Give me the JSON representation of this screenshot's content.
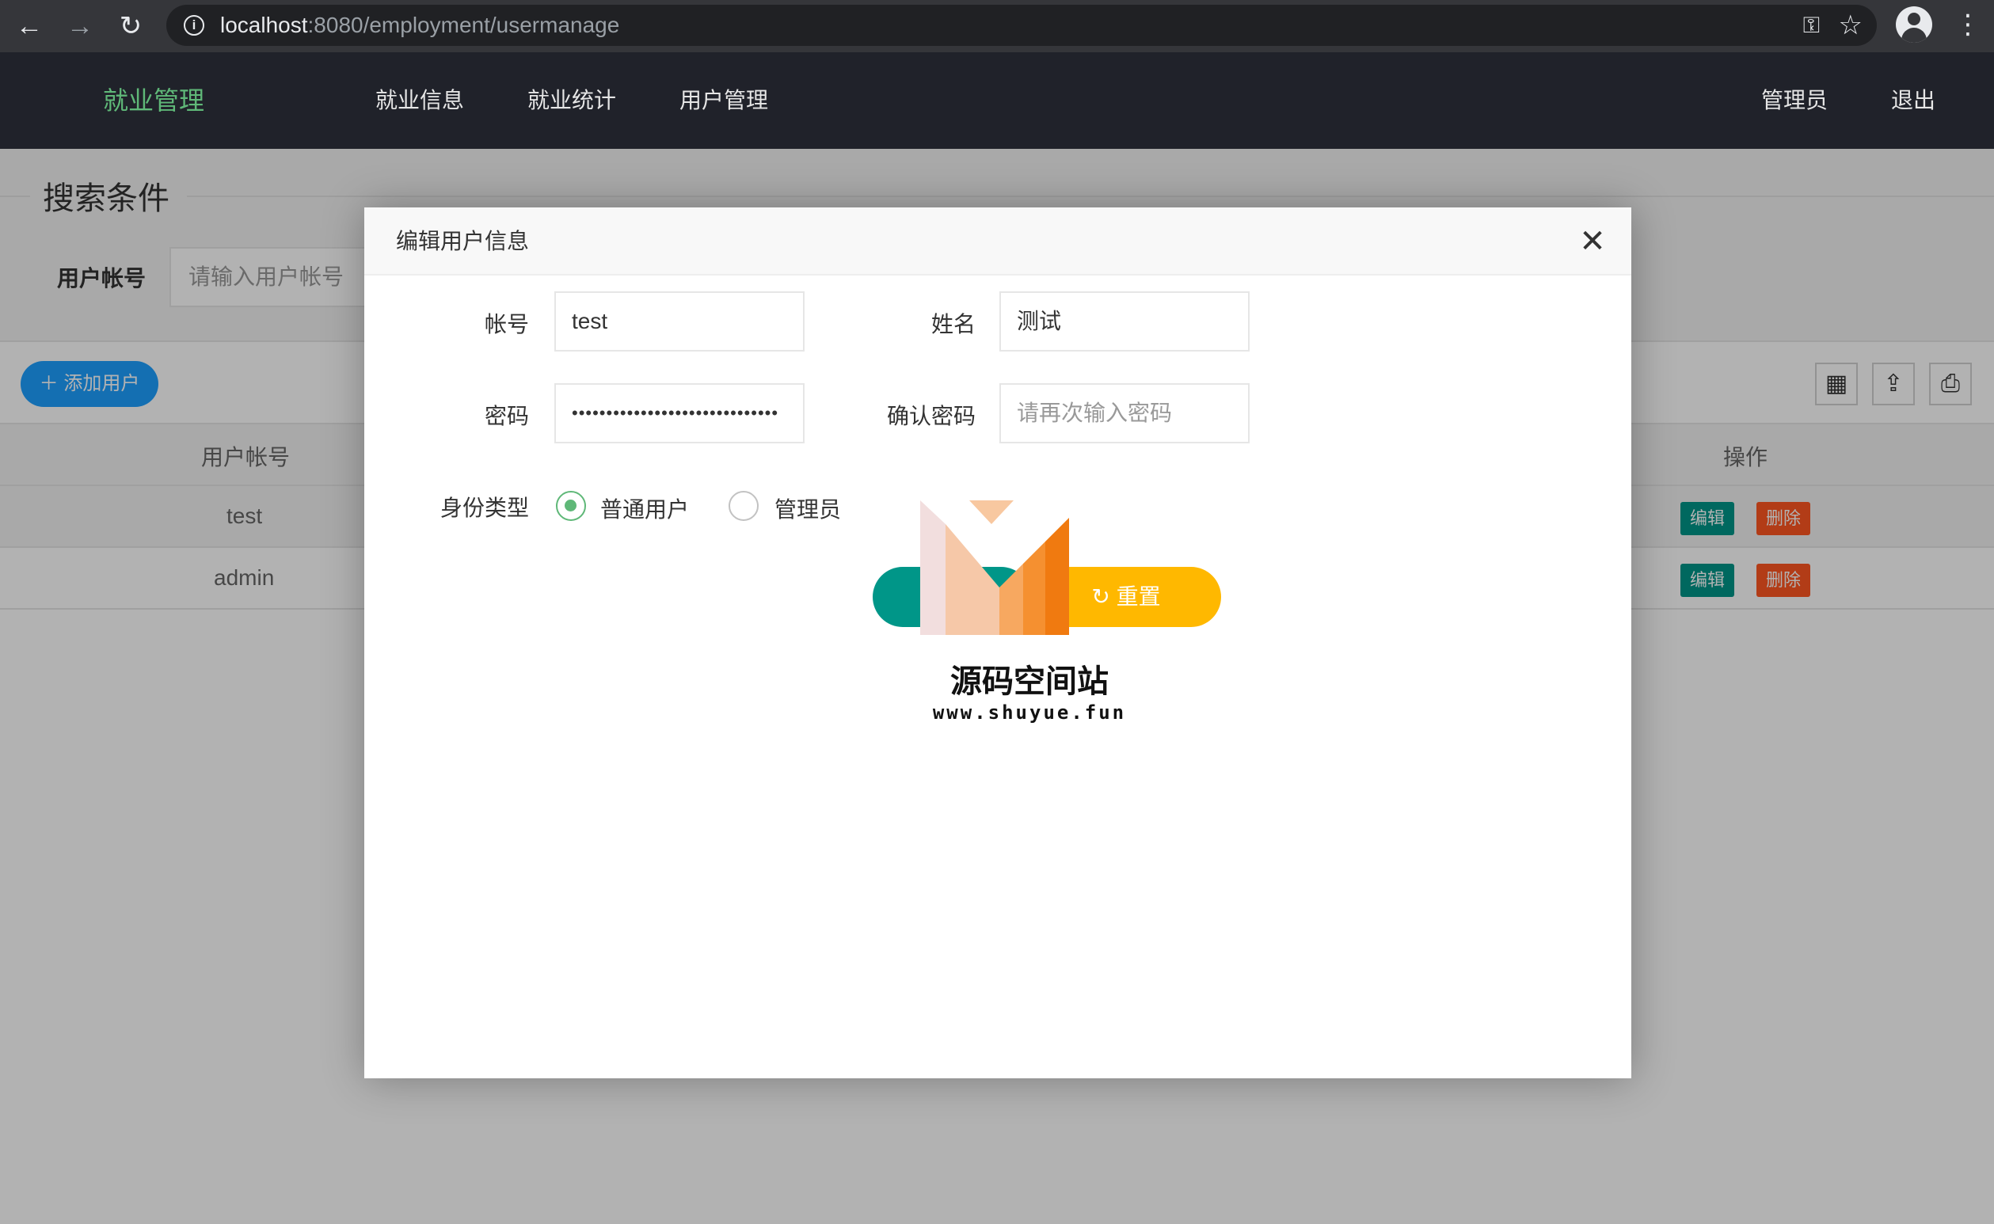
{
  "browser": {
    "url_host": "localhost",
    "url_path": ":8080/employment/usermanage"
  },
  "header": {
    "brand": "就业管理",
    "nav": [
      "就业信息",
      "就业统计",
      "用户管理"
    ],
    "right": [
      "管理员",
      "退出"
    ]
  },
  "search": {
    "legend": "搜索条件",
    "label": "用户帐号",
    "placeholder": "请输入用户帐号"
  },
  "toolbar": {
    "add_label": "添加用户",
    "icons": [
      "columns-icon",
      "export-icon",
      "print-icon"
    ]
  },
  "table": {
    "headers": {
      "account": "用户帐号",
      "actions": "操作"
    },
    "rows": [
      {
        "account": "test",
        "edit": "编辑",
        "delete": "删除"
      },
      {
        "account": "admin",
        "edit": "编辑",
        "delete": "删除"
      }
    ]
  },
  "modal": {
    "title": "编辑用户信息",
    "fields": {
      "account_label": "帐号",
      "account_value": "test",
      "name_label": "姓名",
      "name_value": "测试",
      "password_label": "密码",
      "password_value": "••••••••••••••••••••••••••••••",
      "confirm_label": "确认密码",
      "confirm_placeholder": "请再次输入密码",
      "role_label": "身份类型",
      "role_options": [
        "普通用户",
        "管理员"
      ],
      "role_selected": "普通用户"
    },
    "submit_label": "提交",
    "reset_label": "重置"
  },
  "watermark": {
    "name": "源码空间站",
    "url": "www.shuyue.fun"
  },
  "colors": {
    "brand_green": "#5fb878",
    "teal": "#009688",
    "orange_red": "#ff5722",
    "blue": "#1e9fff",
    "yellow": "#ffb800",
    "header_bg": "#20222a"
  }
}
